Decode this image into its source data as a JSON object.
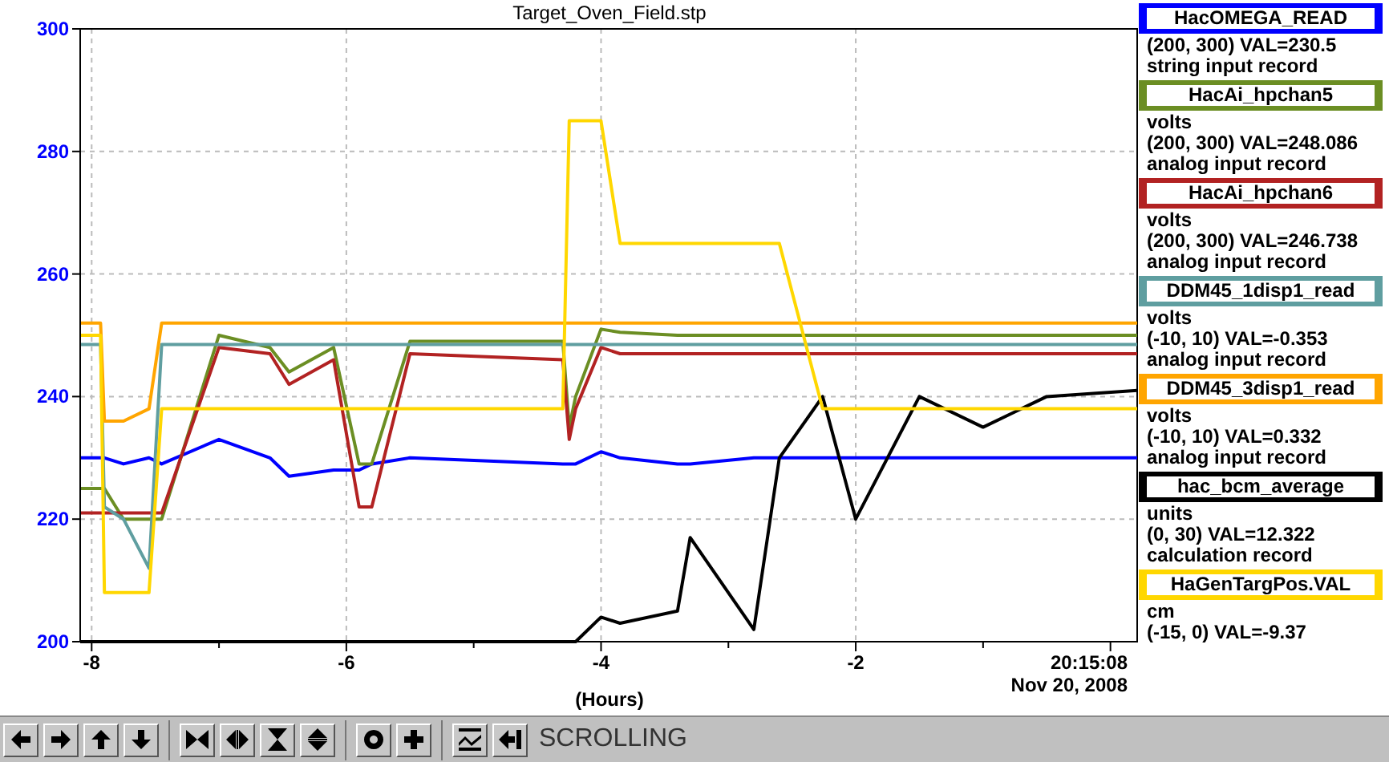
{
  "chart": {
    "chart_data": {
      "type": "line",
      "grid": true,
      "title": "Target_Oven_Field.stp",
      "xlabel": "(Hours)",
      "xlim": [
        -8.09,
        0.21
      ],
      "ylim": [
        200,
        300
      ],
      "xticks": [
        -8,
        -6,
        -4,
        -2
      ],
      "yticks": [
        200,
        220,
        240,
        260,
        280,
        300
      ],
      "x": [
        -8.09,
        -7.93,
        -7.9,
        -7.75,
        -7.55,
        -7.45,
        -7.0,
        -6.6,
        -6.45,
        -6.1,
        -5.9,
        -5.8,
        -5.5,
        -4.3,
        -4.25,
        -4.2,
        -4.0,
        -3.85,
        -3.4,
        -3.3,
        -2.8,
        -2.6,
        -2.26,
        -2.0,
        -1.5,
        -1.0,
        -0.5,
        0.21
      ],
      "series": [
        {
          "name": "HacOMEGA_READ",
          "color": "#0000ff",
          "values": [
            230,
            230,
            230,
            229,
            230,
            229,
            233,
            230,
            227,
            228,
            228,
            229,
            230,
            229,
            229,
            229,
            231,
            230,
            229,
            229,
            230,
            230,
            230,
            230,
            230,
            230,
            230,
            230
          ]
        },
        {
          "name": "HacAi_hpchan5",
          "color": "#6b8e23",
          "values": [
            225,
            225,
            225,
            220,
            220,
            220,
            250,
            248,
            244,
            248,
            229,
            229,
            249,
            249,
            235,
            240,
            251,
            250.5,
            250,
            250,
            250,
            250,
            250,
            250,
            250,
            250,
            250,
            250
          ]
        },
        {
          "name": "HacAi_hpchan6",
          "color": "#b22222",
          "values": [
            221,
            221,
            221,
            221,
            221,
            221,
            248,
            247,
            242,
            246,
            222,
            222,
            247,
            246,
            233,
            238,
            248,
            247,
            247,
            247,
            247,
            247,
            247,
            247,
            247,
            247,
            247,
            247
          ]
        },
        {
          "name": "DDM45_1disp1_read",
          "color": "#5f9ea0",
          "values": [
            248.5,
            248.5,
            222,
            220,
            212,
            248.5,
            248.5,
            248.5,
            248.5,
            248.5,
            248.5,
            248.5,
            248.5,
            248.5,
            248.5,
            248.5,
            248.5,
            248.5,
            248.5,
            248.5,
            248.5,
            248.5,
            248.5,
            248.5,
            248.5,
            248.5,
            248.5,
            248.5
          ]
        },
        {
          "name": "DDM45_3disp1_read",
          "color": "#ffa500",
          "values": [
            252,
            252,
            236,
            236,
            238,
            252,
            252,
            252,
            252,
            252,
            252,
            252,
            252,
            252,
            252,
            252,
            252,
            252,
            252,
            252,
            252,
            252,
            252,
            252,
            252,
            252,
            252,
            252
          ]
        },
        {
          "name": "hac_bcm_average",
          "color": "#000000",
          "values": [
            200,
            200,
            200,
            200,
            200,
            200,
            200,
            200,
            200,
            200,
            200,
            200,
            200,
            200,
            200,
            200,
            204,
            203,
            205,
            217,
            202,
            230,
            240,
            220,
            240,
            235,
            240,
            241
          ]
        },
        {
          "name": "HaGenTargPos.VAL",
          "color": "#ffd700",
          "values": [
            250,
            250,
            208,
            208,
            208,
            238,
            238,
            238,
            238,
            238,
            238,
            238,
            238,
            238,
            285,
            285,
            285,
            265,
            265,
            265,
            265,
            265,
            238,
            238,
            238,
            238,
            238,
            238
          ]
        }
      ]
    },
    "end_time": [
      "20:15:08",
      "Nov 20, 2008"
    ]
  },
  "legend": [
    {
      "lines": [
        "(200, 300) VAL=230.5",
        "string input record"
      ]
    },
    {
      "lines": [
        "volts",
        "(200, 300) VAL=248.086",
        "analog input record"
      ]
    },
    {
      "lines": [
        "volts",
        "(200, 300) VAL=246.738",
        "analog input record"
      ]
    },
    {
      "lines": [
        "volts",
        "(-10, 10) VAL=-0.353",
        "analog input record"
      ]
    },
    {
      "lines": [
        "volts",
        "(-10, 10) VAL=0.332",
        "analog input record"
      ]
    },
    {
      "lines": [
        "units",
        "(0, 30) VAL=12.322",
        "calculation record"
      ]
    },
    {
      "lines": [
        "cm",
        "(-15, 0) VAL=-9.37"
      ]
    }
  ],
  "toolbar": {
    "status": "SCROLLING"
  }
}
